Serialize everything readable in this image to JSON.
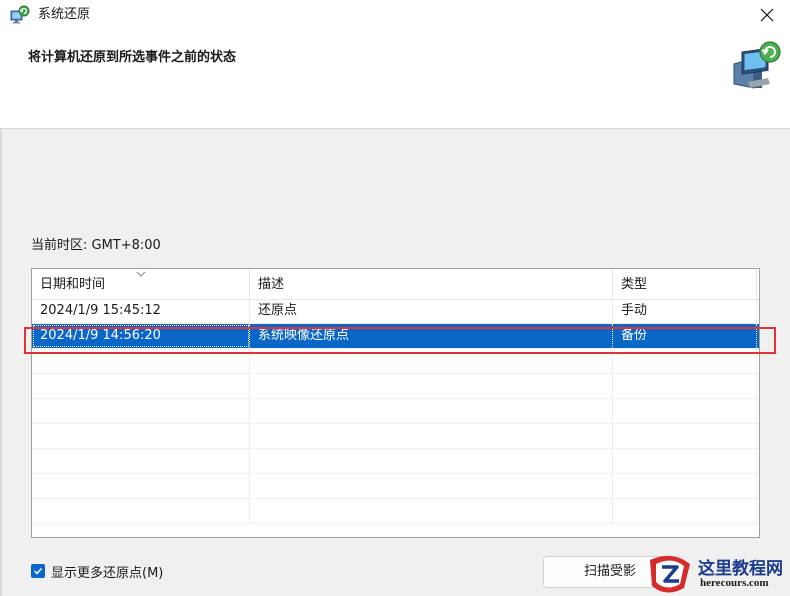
{
  "window": {
    "title": "系统还原"
  },
  "header": {
    "heading": "将计算机还原到所选事件之前的状态"
  },
  "timezone": {
    "label": "当前时区: GMT+8:00"
  },
  "table": {
    "columns": [
      "日期和时间",
      "描述",
      "类型"
    ],
    "rows": [
      {
        "date": "2024/1/9 15:45:12",
        "description": "还原点",
        "type": "手动",
        "selected": false
      },
      {
        "date": "2024/1/9 14:56:20",
        "description": "系统映像还原点",
        "type": "备份",
        "selected": true
      }
    ],
    "empty_rows": 7
  },
  "options": {
    "show_more_label": "显示更多还原点(M)",
    "show_more_checked": true
  },
  "buttons": {
    "scan_label": "扫描受影"
  },
  "watermark": {
    "cn": "这里教程网",
    "en": "herecours.com"
  },
  "colors": {
    "selection": "#0a67c8",
    "highlight": "#e0333b"
  }
}
